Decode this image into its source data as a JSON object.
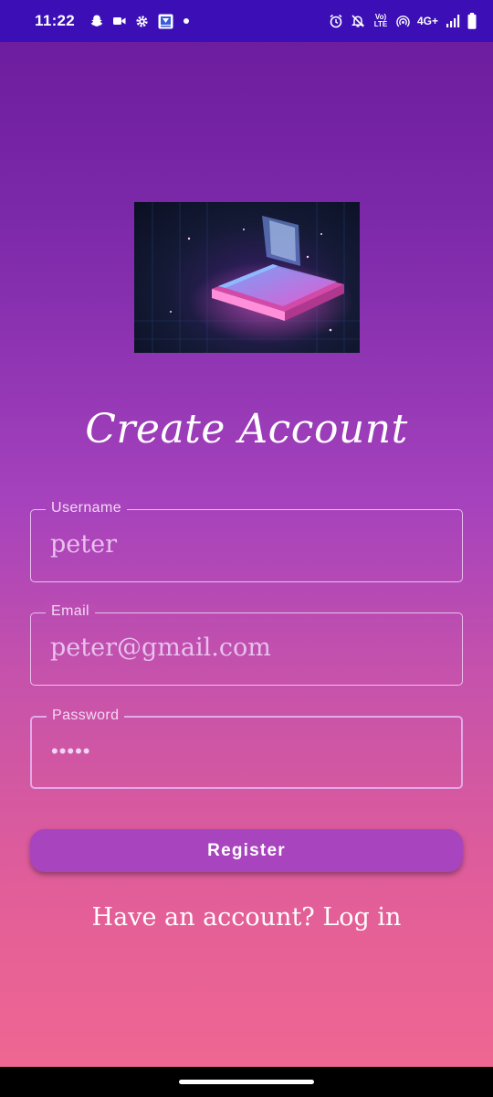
{
  "status_bar": {
    "time": "11:22",
    "volte": "Vo) LTE",
    "network": "4G+",
    "icons": [
      "snapchat-icon",
      "video-camera-icon",
      "gear-icon",
      "app-notification-icon",
      "dot-icon",
      "alarm-icon",
      "bell-off-icon",
      "volte-icon",
      "hotspot-icon",
      "signal-icon",
      "battery-icon"
    ]
  },
  "screen": {
    "title": "Create Account",
    "hero_image": "book-illustration",
    "fields": {
      "username": {
        "label": "Username",
        "value": "peter"
      },
      "email": {
        "label": "Email",
        "value": "peter@gmail.com"
      },
      "password": {
        "label": "Password",
        "value": "•••••"
      }
    },
    "register_label": "Register",
    "login_link": "Have an account? Log in"
  },
  "colors": {
    "status_bar": "#3b0fb5",
    "gradient_top": "#6d1d9f",
    "gradient_bottom": "#ef6692",
    "button": "#a944bf"
  }
}
